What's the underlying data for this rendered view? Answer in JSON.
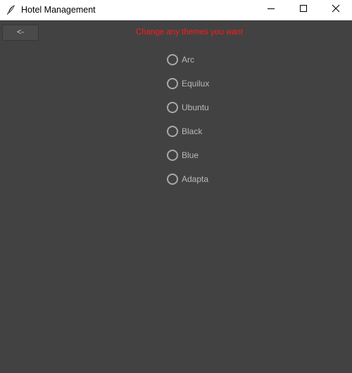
{
  "window": {
    "title": "Hotel Management"
  },
  "toolbar": {
    "back_label": "<-"
  },
  "main": {
    "header": "Change any themes you want",
    "themes": [
      {
        "label": "Arc",
        "selected": false
      },
      {
        "label": "Equilux",
        "selected": false
      },
      {
        "label": "Ubuntu",
        "selected": false
      },
      {
        "label": "Black",
        "selected": false
      },
      {
        "label": "Blue",
        "selected": false
      },
      {
        "label": "Adapta",
        "selected": false
      }
    ]
  },
  "colors": {
    "background": "#424242",
    "header_text": "#ff1a1a",
    "radio_text": "#b9b9b9",
    "radio_ring": "#a9a9a9",
    "titlebar": "#ffffff"
  },
  "icons": {
    "app": "feather-icon",
    "minimize": "minimize-icon",
    "maximize": "maximize-icon",
    "close": "close-icon"
  }
}
